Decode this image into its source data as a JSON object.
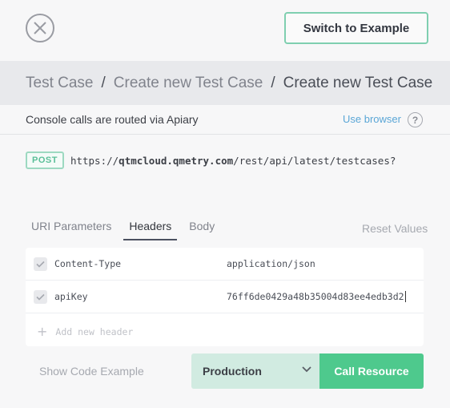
{
  "header": {
    "switch_label": "Switch to Example"
  },
  "breadcrumb": {
    "items": [
      "Test Case",
      "Create new Test Case",
      "Create new Test Case"
    ],
    "separator": "/"
  },
  "routing": {
    "message": "Console calls are routed via Apiary",
    "use_browser_label": "Use browser",
    "help_label": "?"
  },
  "request": {
    "method": "POST",
    "url_prefix": "https://",
    "url_host": "qtmcloud.qmetry.com",
    "url_path": "/rest/api/latest/testcases?"
  },
  "tabs": {
    "items": [
      "URI Parameters",
      "Headers",
      "Body"
    ],
    "active": "Headers",
    "reset_label": "Reset Values"
  },
  "headers": {
    "rows": [
      {
        "key": "Content-Type",
        "value": "application/json"
      },
      {
        "key": "apiKey",
        "value": "76ff6de0429a48b35004d83ee4edb3d2"
      }
    ],
    "add_placeholder": "Add new header"
  },
  "footer": {
    "show_code_label": "Show Code Example",
    "environment": "Production",
    "call_label": "Call Resource"
  },
  "colors": {
    "accent_green": "#4ec98d",
    "env_bg": "#d1ebe1",
    "link_blue": "#5aa6d6",
    "breadcrumb_bg": "#e8e9ec"
  },
  "icons": {
    "close": "close-icon",
    "help": "help-icon",
    "check": "checkmark-icon",
    "plus": "plus-icon",
    "chevron": "chevron-down-icon"
  }
}
